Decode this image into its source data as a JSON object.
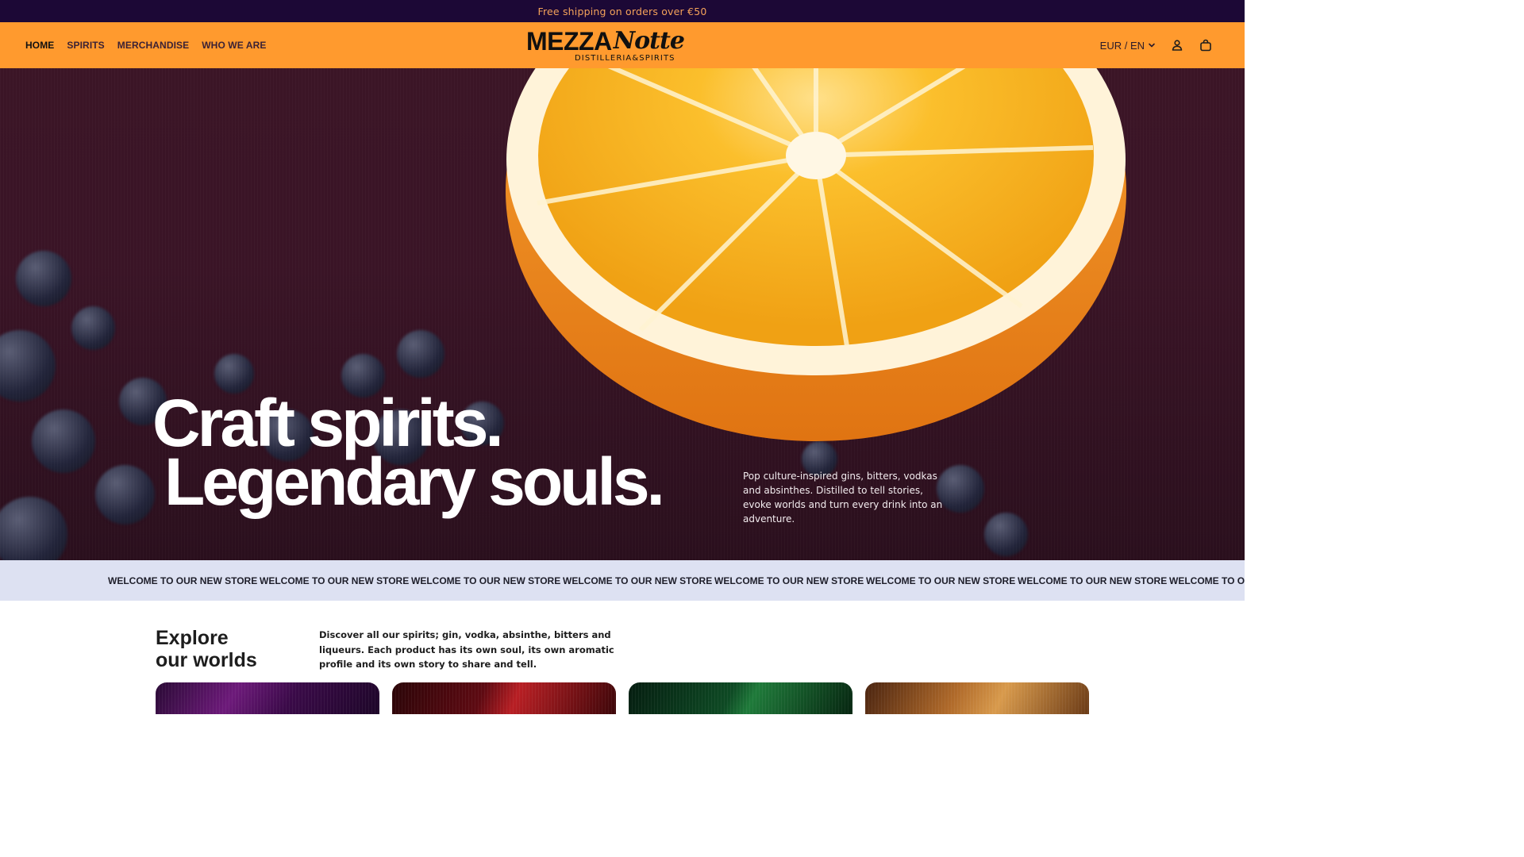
{
  "announcement": {
    "text": "Free shipping on orders over €50"
  },
  "nav": {
    "items": [
      {
        "label": "HOME",
        "active": true
      },
      {
        "label": "SPIRITS",
        "active": false
      },
      {
        "label": "MERCHANDISE",
        "active": false
      },
      {
        "label": "WHO WE ARE",
        "active": false
      }
    ]
  },
  "logo": {
    "brand_block": "MEZZA",
    "brand_script": "Notte",
    "tagline": "DISTILLERIA&SPIRITS"
  },
  "header_right": {
    "locale": "EUR / EN",
    "icons": [
      "chevron-down-icon",
      "account-icon",
      "cart-icon"
    ]
  },
  "hero": {
    "headline_line1": "Craft spirits.",
    "headline_line2": "Legendary souls.",
    "description": "Pop culture-inspired gins, bitters, vodkas and absinthes. Distilled to tell stories, evoke worlds and turn every drink into an adventure."
  },
  "marquee": {
    "items": [
      "WELCOME TO OUR NEW STORE",
      "WELCOME TO OUR NEW STORE",
      "WELCOME TO OUR NEW STORE",
      "WELCOME TO OUR NEW STORE",
      "WELCOME TO OUR NEW STORE",
      "WELCOME TO OUR NEW STORE",
      "WELCOME TO OUR NEW STORE",
      "WELCOME TO OUR NEW STORE"
    ]
  },
  "explore": {
    "title_line1": "Explore",
    "title_line2": "our worlds",
    "description": "Discover all our spirits; gin, vodka, absinthe, bitters and liqueurs. Each product has its own soul, its own aromatic profile and its own story to share and tell."
  },
  "colors": {
    "announcement_bg": "#1c0836",
    "announcement_text": "#f4a25a",
    "header_bg": "#ff9a2e",
    "hero_bg": "#3a1426",
    "marquee_bg": "#dde1f2"
  }
}
